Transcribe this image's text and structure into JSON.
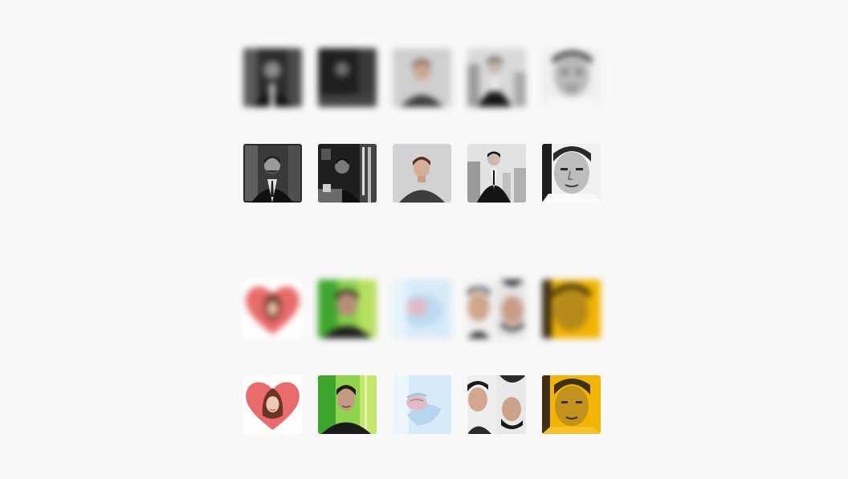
{
  "gallery": {
    "set_monochrome": {
      "avatars": [
        {
          "icon": "person-suit-bw",
          "bg": "#2b2b2b",
          "accent": "#8a8a8a"
        },
        {
          "icon": "person-room-bw",
          "bg": "#1f1f1f",
          "accent": "#6e6e6e"
        },
        {
          "icon": "person-plain-bg",
          "bg": "#cfcfcf",
          "accent": "#5a4a44"
        },
        {
          "icon": "person-suit-office",
          "bg": "#d9d9d9",
          "accent": "#161616"
        },
        {
          "icon": "person-closeup-bw",
          "bg": "#efefef",
          "accent": "#303030"
        }
      ]
    },
    "set_effects": {
      "avatars": [
        {
          "icon": "heart-frame-icon",
          "bg": "#ffffff",
          "accent": "#e96a6a"
        },
        {
          "icon": "green-glow-portrait",
          "bg": "#8ad14b",
          "accent": "#2a2320"
        },
        {
          "icon": "blue-tint-portrait",
          "bg": "#cfe5f6",
          "accent": "#9ec7e8"
        },
        {
          "icon": "split-flipped-portrait",
          "bg": "#f0f0f0",
          "accent": "#2a2a2a"
        },
        {
          "icon": "yellow-duotone-portrait",
          "bg": "#f2b400",
          "accent": "#3b2d14"
        }
      ]
    }
  }
}
